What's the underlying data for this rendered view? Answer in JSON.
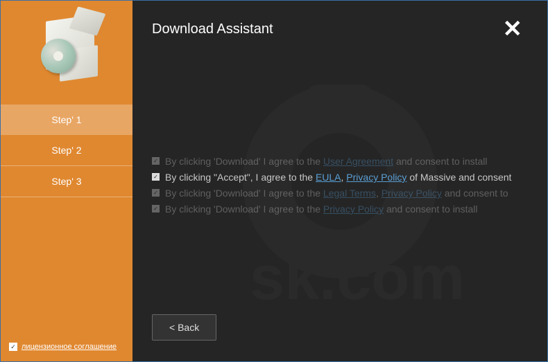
{
  "header": {
    "title": "Download Assistant"
  },
  "sidebar": {
    "steps": [
      {
        "label": "Step' 1",
        "active": true
      },
      {
        "label": "Step' 2",
        "active": false
      },
      {
        "label": "Step' 3",
        "active": false
      }
    ],
    "license_checkbox_checked": true,
    "license_label": "лицензионное соглашение"
  },
  "consents": [
    {
      "prefix": "By clicking 'Download' I agree to the ",
      "links": [
        {
          "text": "User Agreement"
        }
      ],
      "mid": " and consent to install",
      "faded": true
    },
    {
      "prefix": "By clicking \"Accept\", I agree to the ",
      "links": [
        {
          "text": "EULA"
        },
        {
          "text": "Privacy Policy"
        }
      ],
      "joiner": ", ",
      "mid": " of Massive and consent",
      "faded": false
    },
    {
      "prefix": "By clicking 'Download' I agree to the ",
      "links": [
        {
          "text": "Legal Terms"
        },
        {
          "text": "Privacy Policy"
        }
      ],
      "joiner": ", ",
      "mid": " and consent to",
      "faded": true
    },
    {
      "prefix": "By clicking 'Download' I agree to the ",
      "links": [
        {
          "text": "Privacy Policy"
        }
      ],
      "mid": " and consent to install",
      "faded": true
    }
  ],
  "footer": {
    "back_label": "< Back"
  }
}
